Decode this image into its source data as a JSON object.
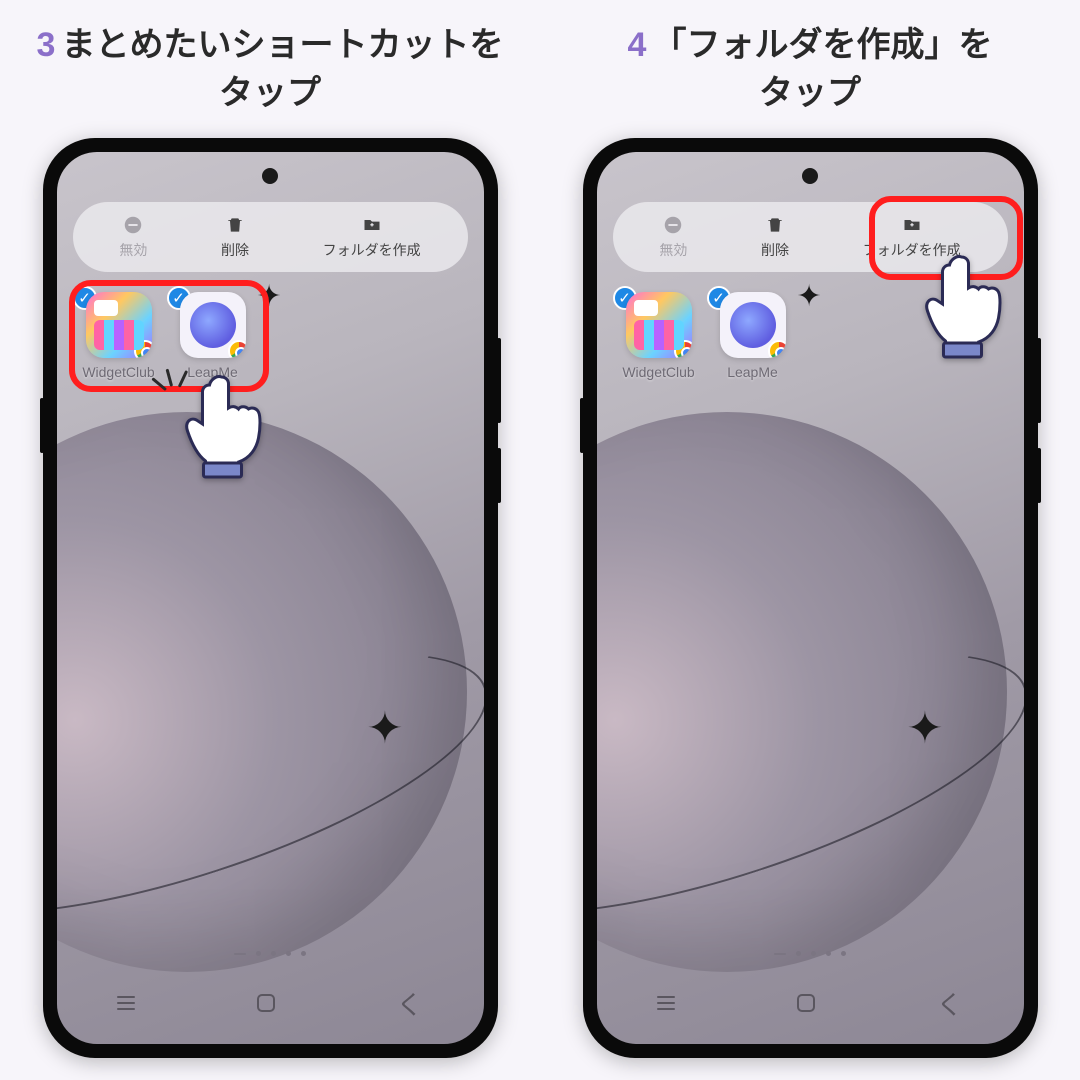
{
  "steps": [
    {
      "num": "3",
      "title": "まとめたいショートカットを\nタップ"
    },
    {
      "num": "4",
      "title": "「フォルダを作成」を\nタップ"
    }
  ],
  "toolbar": {
    "disable": "無効",
    "delete": "削除",
    "create_folder": "フォルダを作成"
  },
  "apps": [
    {
      "id": "widgetclub",
      "label": "WidgetClub"
    },
    {
      "id": "leapme",
      "label": "LeapMe"
    }
  ],
  "icons": {
    "disable": "minus-circle-icon",
    "delete": "trash-icon",
    "create_folder": "folder-plus-icon",
    "check": "check-icon",
    "chrome": "chrome-badge-icon",
    "sparkle": "sparkle-icon"
  },
  "colors": {
    "accent_num": "#8b6fc9",
    "highlight": "#ff1e1e",
    "check_badge": "#1e88e5"
  }
}
